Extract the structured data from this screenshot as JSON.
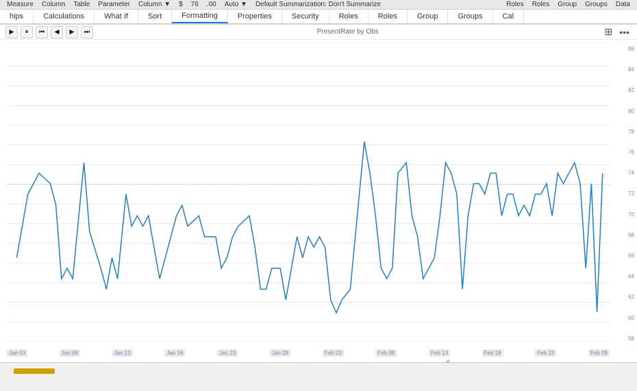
{
  "toolbar": {
    "items": [
      "hips",
      "What If",
      "Sort",
      "Formatting",
      "Properties",
      "Security",
      "Group Groups",
      "Cal"
    ]
  },
  "ribbon": {
    "tabs": [
      {
        "label": "Measure",
        "active": false
      },
      {
        "label": "Column",
        "active": false
      },
      {
        "label": "Table",
        "active": false
      },
      {
        "label": "Parameter",
        "active": false
      },
      {
        "label": "Column ▼",
        "active": false
      }
    ],
    "inputs": [
      {
        "value": "$"
      },
      {
        "value": "76"
      },
      {
        "value": ".00"
      },
      {
        "value": "Auto"
      }
    ],
    "summarization": "Default Summarization: Don't Summarize",
    "right_tabs": [
      {
        "label": "Roles",
        "active": false
      },
      {
        "label": "Roles",
        "active": false
      },
      {
        "label": "Group",
        "active": false
      },
      {
        "label": "Groups",
        "active": false
      },
      {
        "label": "Data",
        "active": false
      }
    ]
  },
  "sub_ribbon": {
    "tabs": [
      {
        "label": "hips",
        "active": false
      },
      {
        "label": "Calculations",
        "active": false
      },
      {
        "label": "What If",
        "active": false
      },
      {
        "label": "Sort",
        "active": false
      },
      {
        "label": "Formatting",
        "active": true
      },
      {
        "label": "Properties",
        "active": false
      },
      {
        "label": "Security",
        "active": false
      },
      {
        "label": "Roles",
        "active": false
      },
      {
        "label": "Roles",
        "active": false
      },
      {
        "label": "Group",
        "active": false
      },
      {
        "label": "Groups",
        "active": false
      },
      {
        "label": "Cal",
        "active": false
      }
    ]
  },
  "chart": {
    "title": "PresentRate by Obs",
    "title_label": "PresentRate by Obs",
    "x_labels": [
      "Jan 03",
      "Jan 08",
      "Jan 13",
      "Jan 18",
      "Jan 23",
      "Jan 28",
      "Feb 03",
      "Feb 08",
      "Feb 13",
      "Feb 18",
      "Feb 23",
      "Feb 28"
    ],
    "y_labels": [
      "86",
      "84",
      "82",
      "80",
      "78",
      "76",
      "74",
      "72",
      "70",
      "68",
      "66",
      "64",
      "62",
      "60",
      "58"
    ],
    "y_min": 58,
    "y_max": 86
  },
  "controls": {
    "play": "▶",
    "pause": "⏸",
    "skip_back": "⏮",
    "back": "◀",
    "forward": "▶",
    "skip_fwd": "⏭"
  },
  "icons": {
    "expand": "⊞",
    "more": "•••"
  }
}
